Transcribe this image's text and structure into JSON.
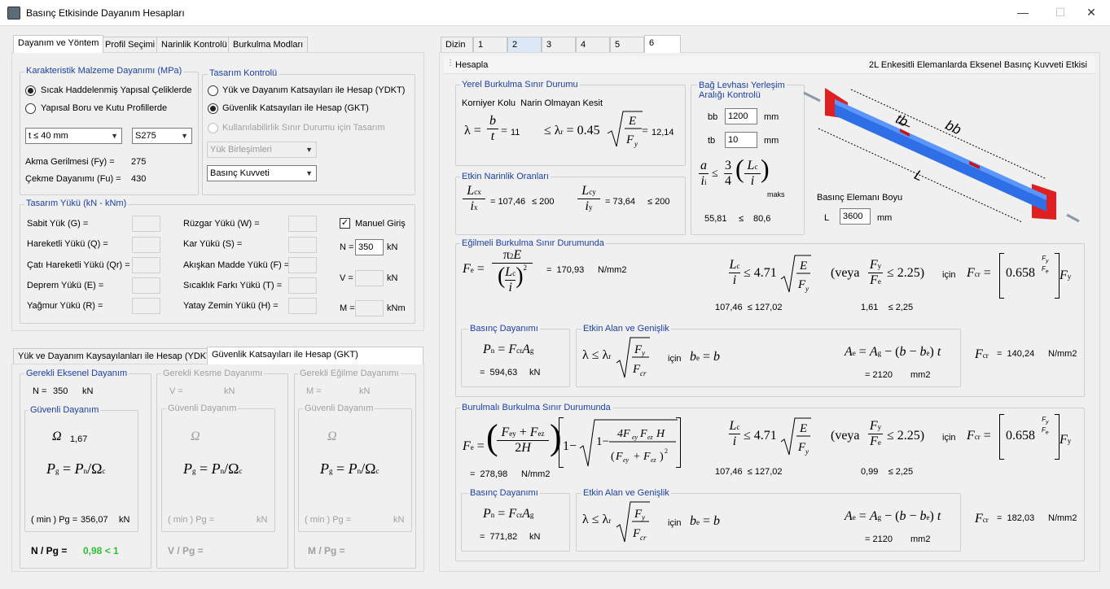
{
  "window": {
    "title": "Basınç Etkisinde Dayanım Hesapları",
    "min": "—",
    "max": "☐",
    "close": "✕"
  },
  "left_tabs": [
    "Dayanım ve Yöntem",
    "Profil Seçimi",
    "Narinlik Kontrolü",
    "Burkulma Modları"
  ],
  "material": {
    "group": "Karakteristik Malzeme Dayanımı (MPa)",
    "opt1": "Sıcak Haddelenmiş Yapısal Çeliklerde",
    "opt2": "Yapısal Boru ve Kutu Profillerde",
    "thickness": "t ≤ 40 mm",
    "steel": "S275",
    "fy_label": "Akma Gerilmesi (Fy) =",
    "fy": "275",
    "fu_label": "Çekme Dayanımı (Fu) =",
    "fu": "430"
  },
  "design": {
    "group": "Tasarım Kontrolü",
    "opt1": "Yük ve Dayanım Katsayıları ile Hesap (YDKT)",
    "opt2": "Güvenlik Katsayıları ile Hesap (GKT)",
    "opt3": "Kullanılabilirlik Sınır Durumu için Tasarım",
    "combo1": "Yük Birleşimleri",
    "combo2": "Basınç Kuvveti"
  },
  "loads": {
    "group": "Tasarım Yükü (kN - kNm)",
    "left": [
      "Sabit Yük (G) =",
      "Hareketli Yükü (Q) =",
      "Çatı Hareketli Yükü (Qr) =",
      "Deprem Yükü (E) =",
      "Yağmur Yükü (R) ="
    ],
    "right": [
      "Rüzgar Yükü (W) =",
      "Kar Yükü (S) =",
      "Akışkan Madde Yükü (F) =",
      "Sıcaklık Farkı Yükü (T) =",
      "Yatay Zemin Yükü (H) ="
    ],
    "manual": "Manuel Giriş",
    "n_label": "N =",
    "n_value": "350",
    "n_unit": "kN",
    "v_label": "V =",
    "v_unit": "kN",
    "m_label": "M =",
    "m_unit": "kNm"
  },
  "bottom_tabs": [
    "Yük ve Dayanım Kaysayılanları ile Hesap (YDKT)",
    "Güvenlik Katsayıları ile Hesap (GKT)"
  ],
  "req_axial": {
    "group": "Gerekli Eksenel Dayanım",
    "n_label": "N =",
    "n_value": "350",
    "unit": "kN",
    "safe": "Güvenli Dayanım",
    "omega": "1,67",
    "pg_label": "( min ) Pg =",
    "pg_value": "356,07",
    "ratio_label": "N / Pg =",
    "ratio": "0,98 < 1"
  },
  "req_shear": {
    "group": "Gerekli Kesme Dayanımı",
    "label": "V =",
    "unit": "kN",
    "safe": "Güvenli Dayanım",
    "pg_label": "( min ) Pg =",
    "ratio_label": "V / Pg ="
  },
  "req_moment": {
    "group": "Gerekli Eğilme Dayanımı",
    "label": "M =",
    "unit": "kN",
    "safe": "Güvenli Dayanım",
    "pg_label": "( min ) Pg =",
    "ratio_label": "M / Pg ="
  },
  "right_tabs": [
    "Dizin",
    "1",
    "2",
    "3",
    "4",
    "5",
    "6"
  ],
  "header": {
    "calc": "Hesapla",
    "title": "2L Enkesitli Elemanlarda Eksenel Basınç Kuvveti Etkisi"
  },
  "local": {
    "group": "Yerel Burkulma Sınır Durumu",
    "sub": "Korniyer Kolu  Narin Olmayan Kesit",
    "lambda": "11",
    "lambda_r": "12,14"
  },
  "plate": {
    "group": "Bağ Levhası Yerleşim Aralığı Kontrolü",
    "bb_label": "bb",
    "bb": "1200",
    "tb_label": "tb",
    "tb": "10",
    "unit": "mm",
    "left": "55,81",
    "le": "≤",
    "right": "80,6"
  },
  "slender": {
    "group": "Etkin Narinlik Oranları",
    "lcx": "107,46",
    "lcx_lim": "≤ 200",
    "lcy": "73,64",
    "lcy_lim": "≤ 200"
  },
  "length": {
    "label": "Basınç Elemanı Boyu",
    "l_label": "L",
    "value": "3600",
    "unit": "mm"
  },
  "flex": {
    "group": "Eğilmeli Burkulma Sınır Durumunda",
    "fe": "170,93",
    "fe_unit": "N/mm2",
    "cond1": "107,46  ≤ 127,02",
    "cond2": "1,61    ≤ 2,25",
    "icin": "için",
    "pn_group": "Basınç Dayanımı",
    "pn": "594,63",
    "pn_unit": "kN",
    "ae_group": "Etkin Alan ve Genişlik",
    "ae": "2120",
    "ae_unit": "mm2",
    "fcr": "140,24",
    "fcr_unit": "N/mm2"
  },
  "tors": {
    "group": "Burulmalı Burkulma Sınır Durumunda",
    "fe": "278,98",
    "fe_unit": "N/mm2",
    "cond1": "107,46  ≤ 127,02",
    "cond2": "0,99    ≤ 2,25",
    "icin": "için",
    "pn_group": "Basınç Dayanımı",
    "pn": "771,82",
    "pn_unit": "kN",
    "ae_group": "Etkin Alan ve Genişlik",
    "ae": "2120",
    "ae_unit": "mm2",
    "fcr": "182,03",
    "fcr_unit": "N/mm2"
  },
  "diagram": {
    "tb": "tb",
    "bb": "bb",
    "L": "L"
  },
  "colors": {
    "beam": "#2e6ee6",
    "plate": "#e02020",
    "group_title": "#1a3fa8",
    "ok": "#2ec02e"
  }
}
